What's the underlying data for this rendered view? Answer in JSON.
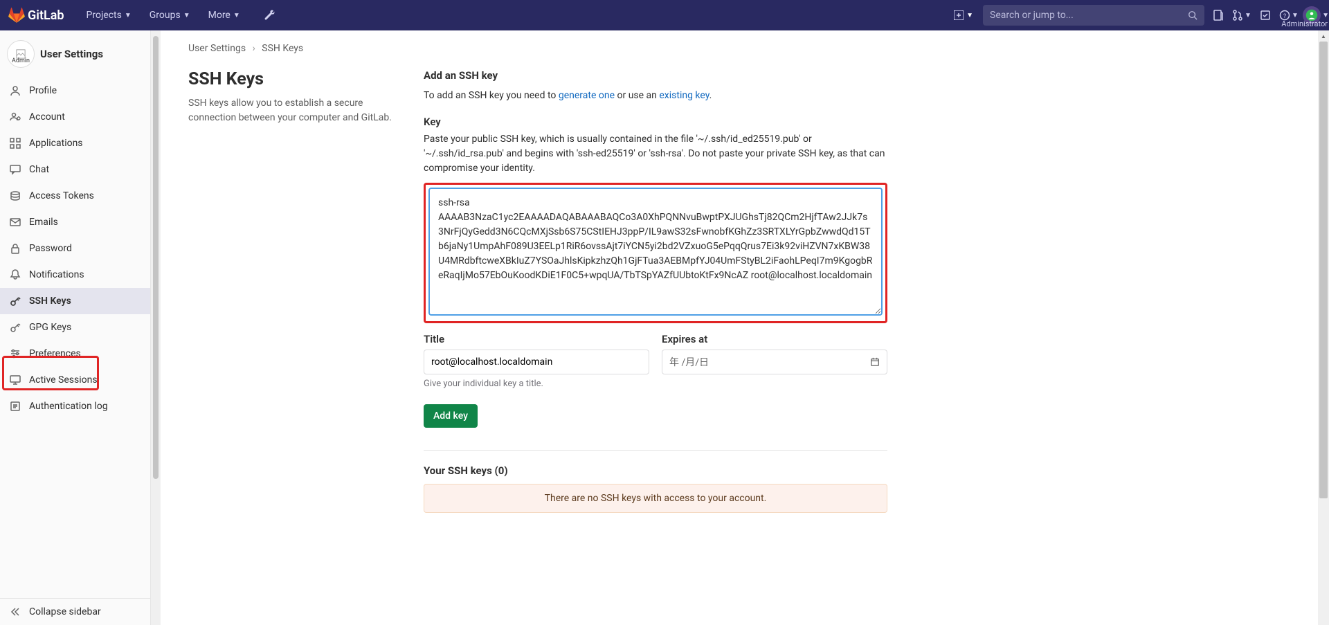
{
  "topbar": {
    "brand": "GitLab",
    "nav": [
      {
        "label": "Projects"
      },
      {
        "label": "Groups"
      },
      {
        "label": "More"
      }
    ],
    "search_placeholder": "Search or jump to...",
    "user_label": "Administrator"
  },
  "sidebar": {
    "title": "User Settings",
    "avatar_alt": "Admin",
    "items": [
      {
        "label": "Profile",
        "icon": "user"
      },
      {
        "label": "Account",
        "icon": "account"
      },
      {
        "label": "Applications",
        "icon": "apps"
      },
      {
        "label": "Chat",
        "icon": "chat"
      },
      {
        "label": "Access Tokens",
        "icon": "token"
      },
      {
        "label": "Emails",
        "icon": "mail"
      },
      {
        "label": "Password",
        "icon": "lock"
      },
      {
        "label": "Notifications",
        "icon": "bell"
      },
      {
        "label": "SSH Keys",
        "icon": "key",
        "active": true
      },
      {
        "label": "GPG Keys",
        "icon": "key"
      },
      {
        "label": "Preferences",
        "icon": "sliders"
      },
      {
        "label": "Active Sessions",
        "icon": "monitor"
      },
      {
        "label": "Authentication log",
        "icon": "list"
      }
    ],
    "collapse_label": "Collapse sidebar"
  },
  "breadcrumb": {
    "parent": "User Settings",
    "current": "SSH Keys"
  },
  "page": {
    "title": "SSH Keys",
    "description": "SSH keys allow you to establish a secure connection between your computer and GitLab."
  },
  "form": {
    "add_heading": "Add an SSH key",
    "add_intro_prefix": "To add an SSH key you need to ",
    "add_intro_link1": "generate one",
    "add_intro_middle": " or use an ",
    "add_intro_link2": "existing key",
    "add_intro_suffix": ".",
    "key_label": "Key",
    "key_help": "Paste your public SSH key, which is usually contained in the file '~/.ssh/id_ed25519.pub' or '~/.ssh/id_rsa.pub' and begins with 'ssh-ed25519' or 'ssh-rsa'. Do not paste your private SSH key, as that can compromise your identity.",
    "key_value": "ssh-rsa AAAAB3NzaC1yc2EAAAADAQABAAABAQCo3A0XhPQNNvuBwptPXJUGhsTj82QCm2HjfTAw2JJk7s3NrFjQyGedd3N6CQcMXjSsb6S75CStIEHJ3ppP/IL9awS32sFwnobfKGhZz3SRTXLYrGpbZwwdQd15Tb6jaNy1UmpAhF089U3EELp1RiR6ovssAjt7iYCN5yi2bd2VZxuoG5ePqqQrus7Ei3k92viHZVN7xKBW38U4MRdbftcweXBkIuZ7YSOaJhlsKipkzhzQh1GjFTua3AEBMpfYJ04UmFStyBL2iFaohLPeqI7m9KgogbReRaqIjMo57EbOuKoodKDiE1F0C5+wpqUA/TbTSpYAZfUUbtoKtFx9NcAZ root@localhost.localdomain",
    "title_label": "Title",
    "title_value": "root@localhost.localdomain",
    "title_help": "Give your individual key a title.",
    "expires_label": "Expires at",
    "expires_placeholder": "年 /月/日",
    "add_button": "Add key"
  },
  "list": {
    "heading": "Your SSH keys (0)",
    "empty_message": "There are no SSH keys with access to your account."
  }
}
